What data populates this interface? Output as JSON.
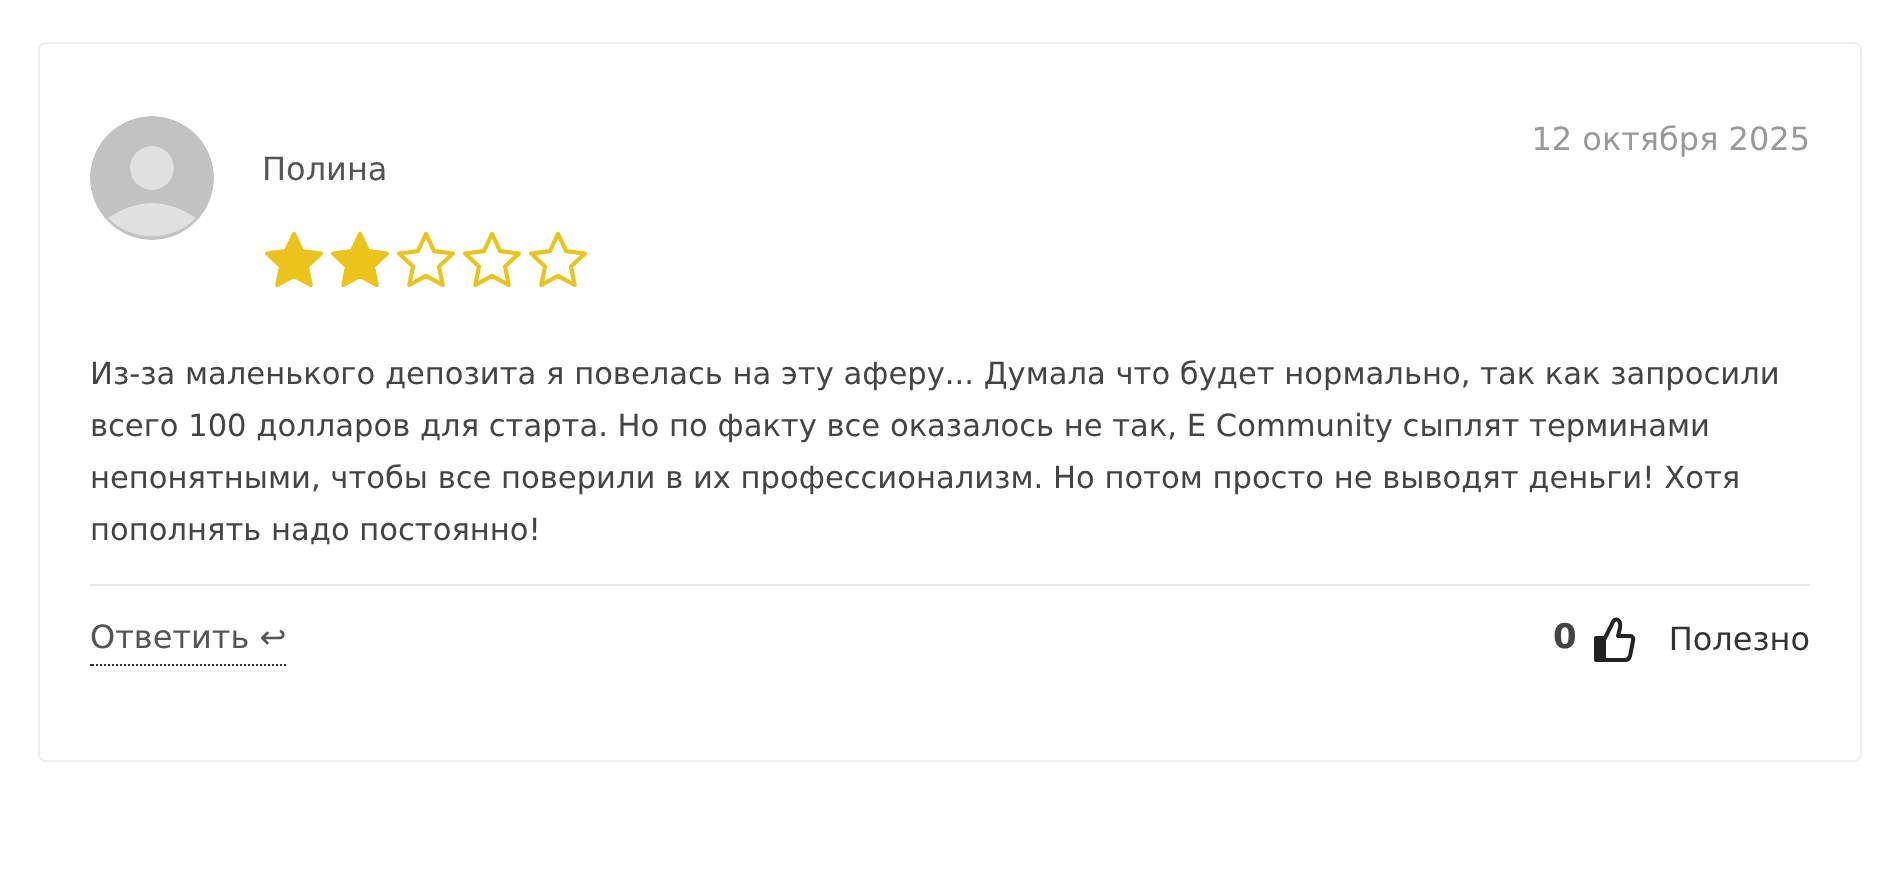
{
  "review": {
    "author": "Полина",
    "date": "12 октября 2025",
    "stars": 2,
    "text": "Из-за маленького депозита я повелась на эту аферу... Думала что будет нормально, так как запросили всего 100 долларов для старта. Но по факту все оказалось не так, E Community сыплят терминами непонятными, чтобы все поверили в их профессионализм. Но потом просто не выводят деньги! Хотя пополнять надо постоянно!",
    "reply_label": "Ответить",
    "reply_icon": "↩",
    "likes": "0",
    "helpful_label": "Полезно"
  }
}
